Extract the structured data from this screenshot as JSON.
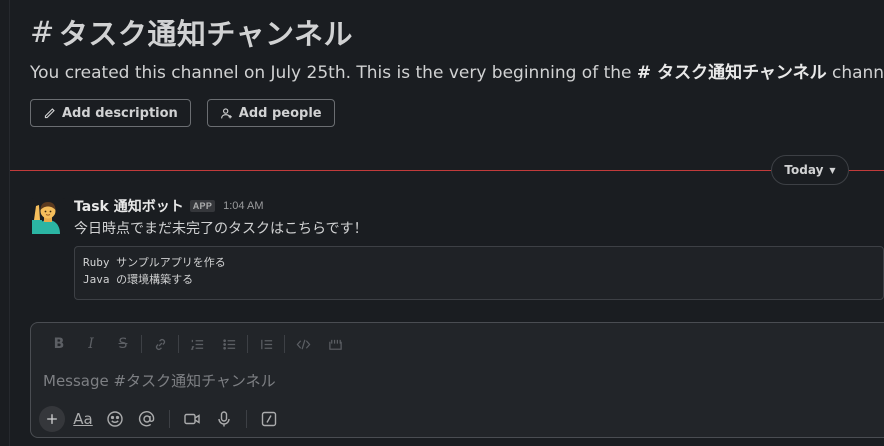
{
  "channel": {
    "hash": "#",
    "name": "タスク通知チャンネル",
    "intro_prefix": "You created this channel on July 25th. This is the very beginning of the ",
    "intro_hash": "#",
    "intro_name": "タスク通知チャンネル",
    "intro_suffix": " channel."
  },
  "buttons": {
    "add_description": "Add description",
    "add_people": "Add people"
  },
  "divider": {
    "label": "Today",
    "color": "#c13b3b"
  },
  "message": {
    "sender": "Task 通知ボット",
    "badge": "APP",
    "time": "1:04 AM",
    "text": "今日時点でまだ未完了のタスクはこちらです！",
    "code_lines": [
      "Ruby サンプルアプリを作る",
      "Java の環境構築する"
    ]
  },
  "composer": {
    "placeholder": "Message #タスク通知チャンネル",
    "text_format_label": "Aa"
  },
  "icons": {
    "formatting": [
      "bold-icon",
      "italic-icon",
      "strikethrough-icon",
      "link-icon",
      "ordered-list-icon",
      "bulleted-list-icon",
      "blockquote-icon",
      "code-icon",
      "code-block-icon"
    ],
    "actions": [
      "plus-icon",
      "text-format-icon",
      "emoji-icon",
      "mention-icon",
      "video-icon",
      "microphone-icon",
      "slash-command-icon"
    ]
  }
}
